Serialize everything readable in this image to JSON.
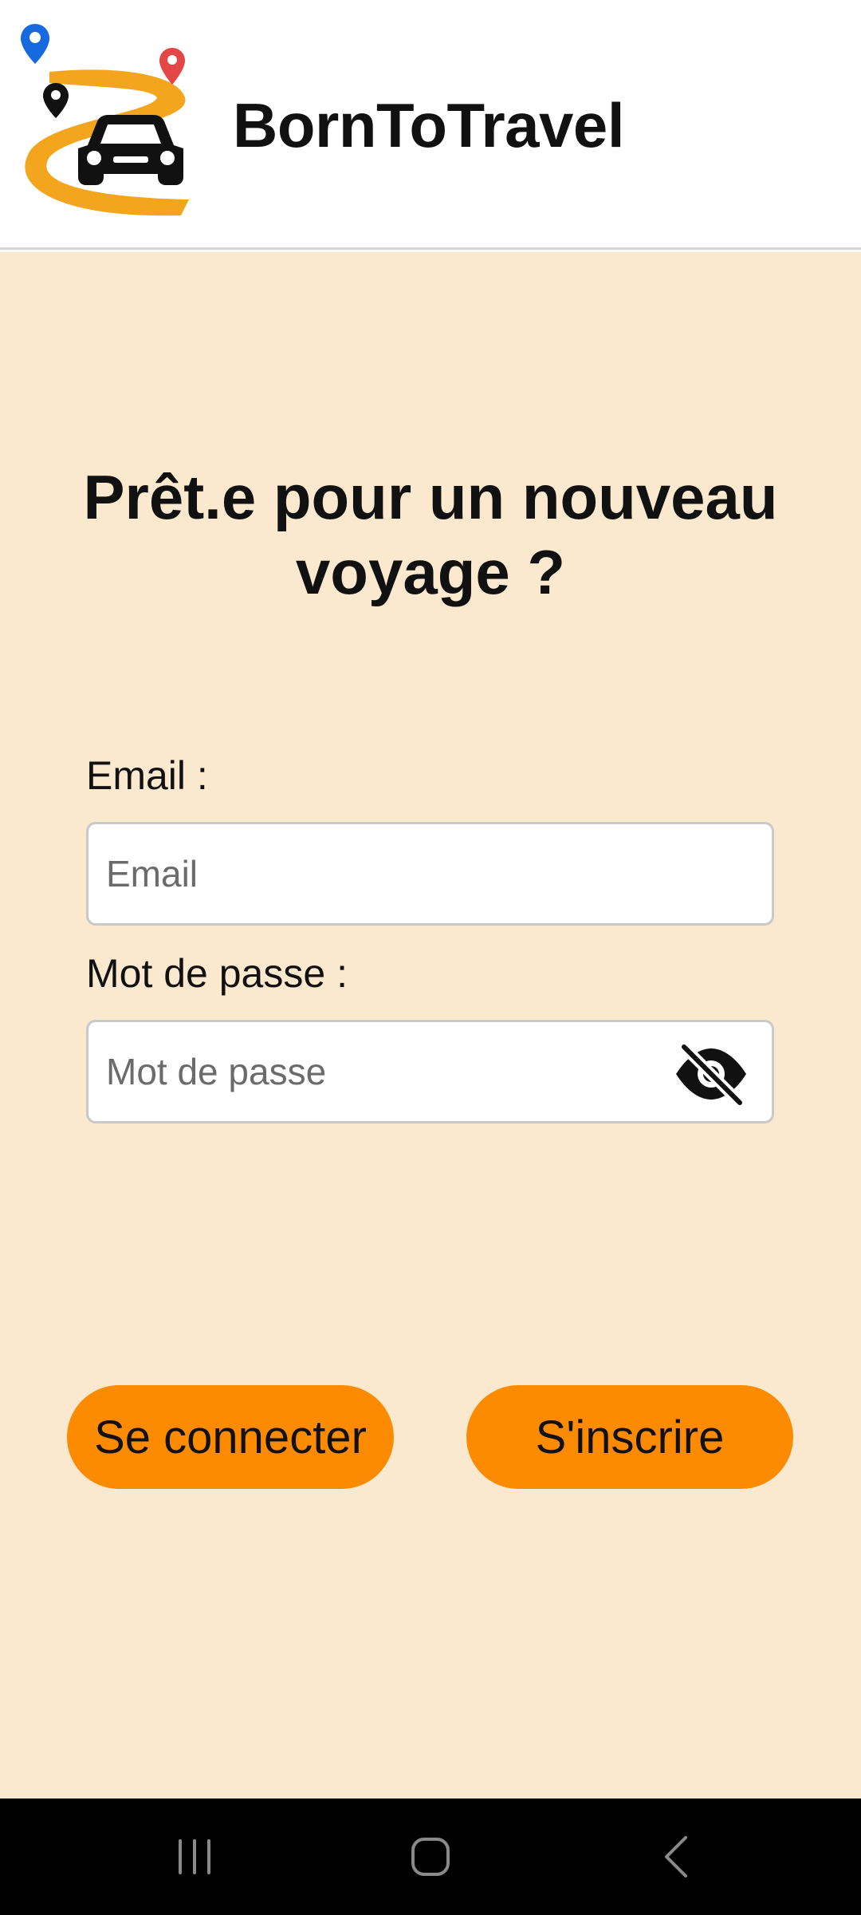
{
  "header": {
    "app_title": "BornToTravel",
    "logo_icon": "road-car-map-pins-logo"
  },
  "main": {
    "headline": "Prêt.e pour un nouveau voyage ?",
    "email": {
      "label": "Email :",
      "placeholder": "Email",
      "value": ""
    },
    "password": {
      "label": "Mot de passe :",
      "placeholder": "Mot de passe",
      "value": "",
      "visibility_icon": "eye-slash-icon"
    },
    "buttons": {
      "login_label": "Se connecter",
      "register_label": "S'inscrire"
    }
  },
  "navbar": {
    "recent_icon": "recent-apps-icon",
    "home_icon": "home-icon",
    "back_icon": "back-icon"
  },
  "colors": {
    "background": "#fbe9cf",
    "accent": "#fd8b02",
    "header_bg": "#ffffff",
    "navbar_bg": "#000000"
  }
}
